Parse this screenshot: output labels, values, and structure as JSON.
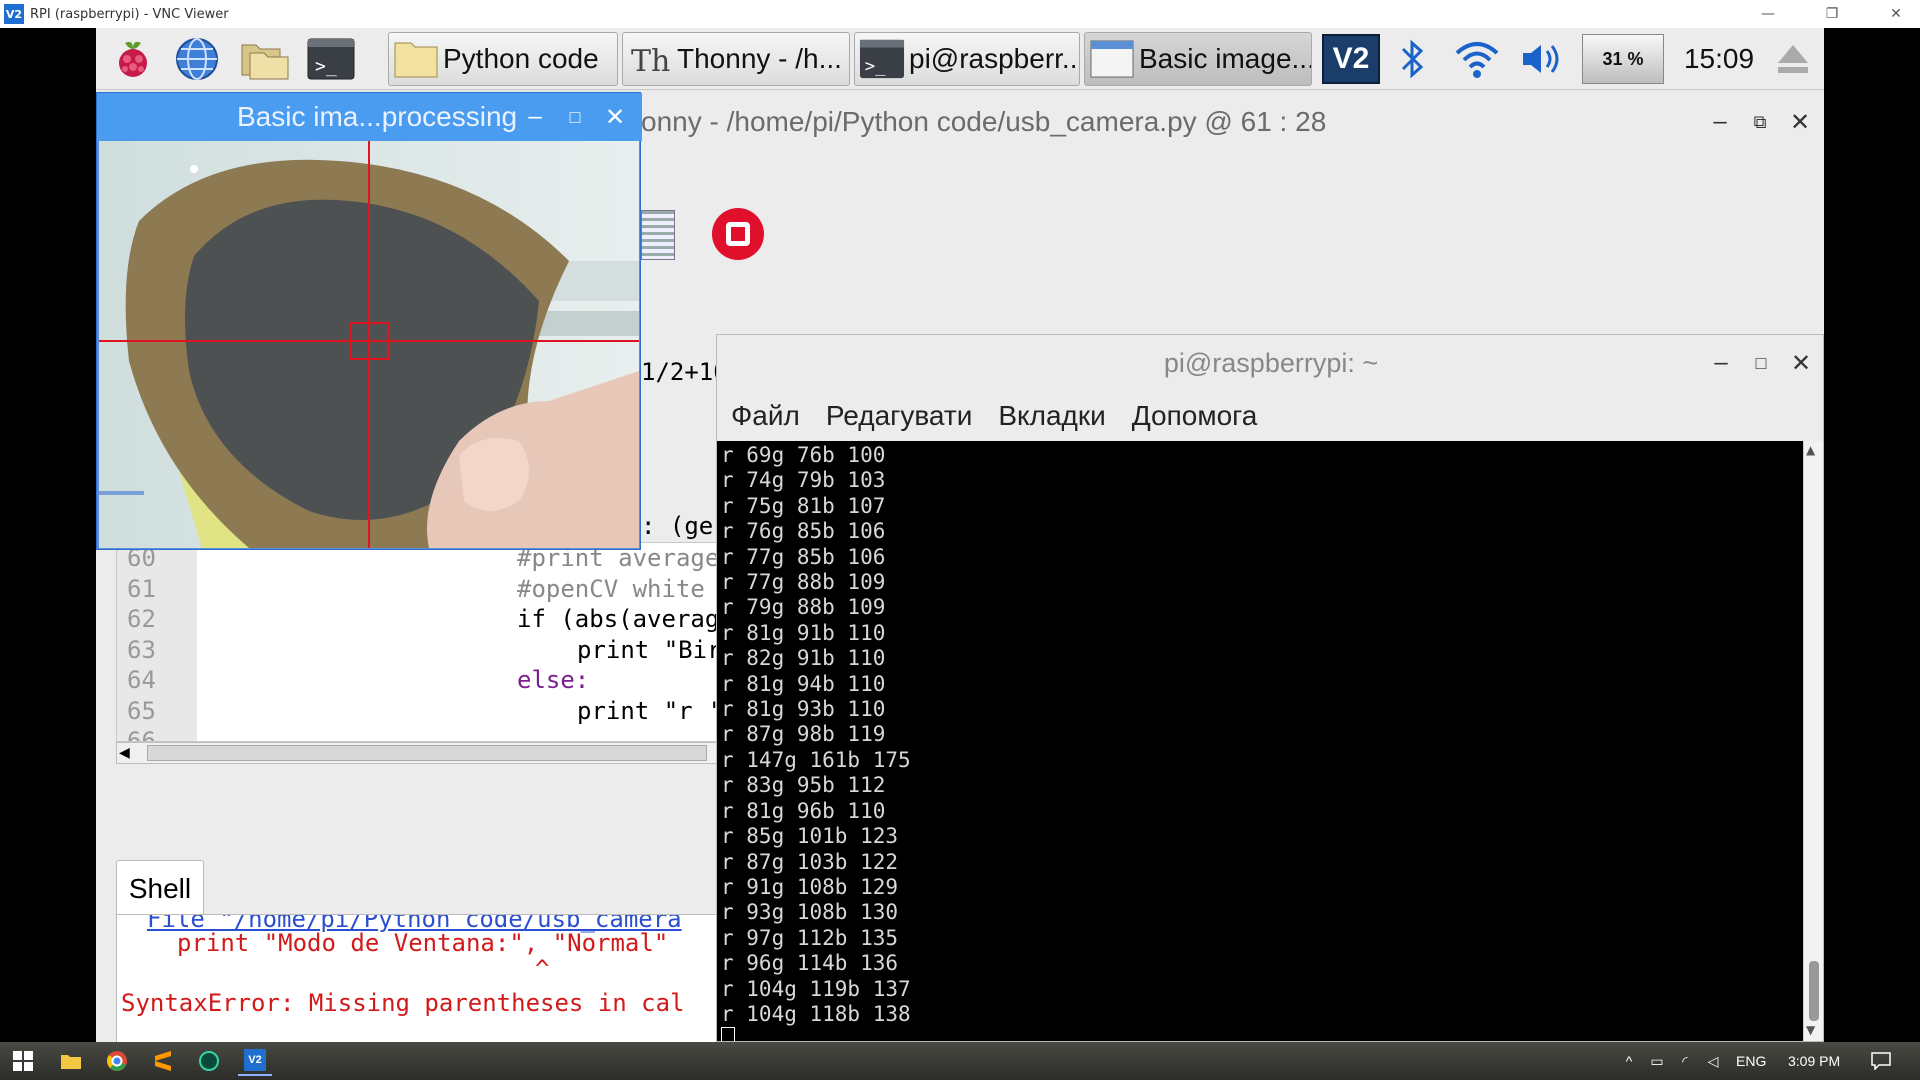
{
  "vnc": {
    "title": "RPI (raspberrypi) - VNC Viewer",
    "logo": "V2"
  },
  "panel": {
    "tasks": [
      {
        "label": "Python code",
        "icon": "folder-icon"
      },
      {
        "label": "Thonny  -  /h...",
        "icon": "thonny-icon"
      },
      {
        "label": "pi@raspberr...",
        "icon": "terminal-icon"
      },
      {
        "label": "Basic image...",
        "icon": "window-icon"
      }
    ],
    "battery": "31 %",
    "clock": "15:09",
    "vnc_tray": "V2"
  },
  "thonny": {
    "title": "onny  -  /home/pi/Python code/usb_camera.py  @  61 : 28",
    "partial_code_1": "1/2+10",
    "partial_code_2": ": (ger",
    "lines": [
      {
        "num": "60",
        "text": "#print average"
      },
      {
        "num": "61",
        "text": "#openCV white"
      },
      {
        "num": "62",
        "text": "if (abs(averag"
      },
      {
        "num": "63",
        "text": "print \"Bir"
      },
      {
        "num": "64",
        "text": "else:"
      },
      {
        "num": "65",
        "text": "print \"r '"
      },
      {
        "num": "66",
        "text": ""
      }
    ],
    "shell_tab": "Shell",
    "shell": {
      "file_line": "File \"/home/pi/Python code/usb_camera",
      "print_line": "print \"Modo de Ventana:\", \"Normal\"",
      "caret": "^",
      "error": "SyntaxError: Missing parentheses in cal",
      "prompt": ">>>"
    }
  },
  "camera_window": {
    "title": "Basic ima...processing"
  },
  "terminal": {
    "title": "pi@raspberrypi: ~",
    "menu": [
      "Файл",
      "Редагувати",
      "Вкладки",
      "Допомога"
    ],
    "lines": [
      "r 69g 76b 100",
      "r 74g 79b 103",
      "r 75g 81b 107",
      "r 76g 85b 106",
      "r 77g 85b 106",
      "r 77g 88b 109",
      "r 79g 88b 109",
      "r 81g 91b 110",
      "r 82g 91b 110",
      "r 81g 94b 110",
      "r 81g 93b 110",
      "r 87g 98b 119",
      "r 147g 161b 175",
      "r 83g 95b 112",
      "r 81g 96b 110",
      "r 85g 101b 123",
      "r 87g 103b 122",
      "r 91g 108b 129",
      "r 93g 108b 130",
      "r 97g 112b 135",
      "r 96g 114b 136",
      "r 104g 119b 137",
      "r 104g 118b 138"
    ]
  },
  "windows_taskbar": {
    "language": "ENG",
    "time": "3:09 PM"
  },
  "colors": {
    "thonny_keyword": "#7a1f8c",
    "shell_error": "#d11a1a",
    "camera_titlebar": "#4a9cf0",
    "crosshair": "#e0141e"
  }
}
